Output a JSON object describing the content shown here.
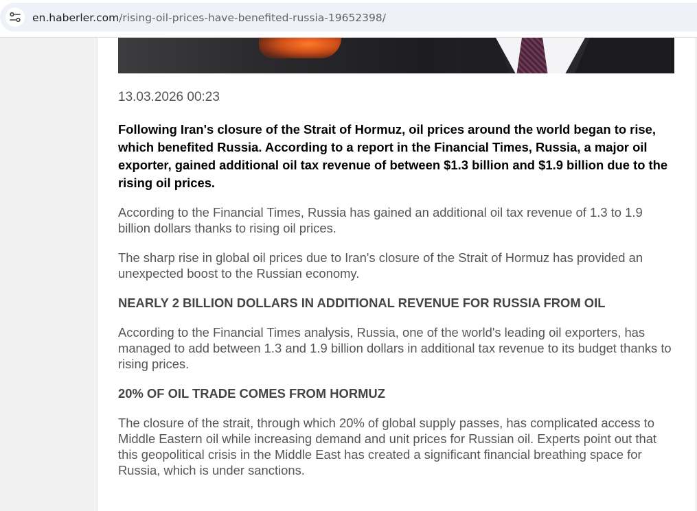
{
  "browser": {
    "url_domain": "en.haberler.com",
    "url_path": "/rising-oil-prices-have-benefited-russia-19652398/",
    "site_info_icon": "tune-icon"
  },
  "article": {
    "date": "13.03.2026 00:23",
    "lead": "Following Iran's closure of the Strait of Hormuz, oil prices around the world began to rise, which benefited Russia. According to a report in the Financial Times, Russia, a major oil exporter, gained additional oil tax revenue of between $1.3 billion and $1.9 billion due to the rising oil prices.",
    "paragraph_1": "According to the Financial Times, Russia has gained an additional oil tax revenue of 1.3 to 1.9 billion dollars thanks to rising oil prices.",
    "paragraph_2": "The sharp rise in global oil prices due to Iran's closure of the Strait of Hormuz has provided an unexpected boost to the Russian economy.",
    "heading_1": "NEARLY 2 BILLION DOLLARS IN ADDITIONAL REVENUE FOR RUSSIA FROM OIL",
    "paragraph_3": "According to the Financial Times analysis, Russia, one of the world's leading oil exporters, has managed to add between 1.3 and 1.9 billion dollars in additional tax revenue to its budget thanks to rising prices.",
    "heading_2": "20% OF OIL TRADE COMES FROM HORMUZ",
    "paragraph_4": "The closure of the strait, through which 20% of global supply passes, has complicated access to Middle Eastern oil while increasing demand and unit prices for Russian oil. Experts point out that this geopolitical crisis in the Middle East has created a significant financial breathing space for Russia, which is under sanctions."
  }
}
